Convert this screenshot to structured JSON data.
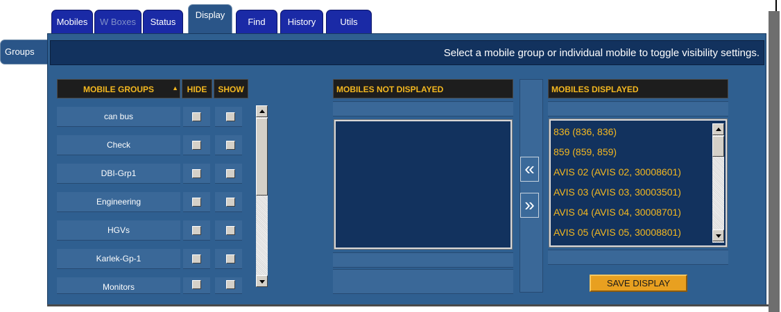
{
  "tabs": [
    {
      "label": "Mobiles",
      "active": false,
      "disabled": false
    },
    {
      "label": "W Boxes",
      "active": false,
      "disabled": true
    },
    {
      "label": "Status",
      "active": false,
      "disabled": false
    },
    {
      "label": "Display",
      "active": true,
      "disabled": false
    },
    {
      "label": "Find",
      "active": false,
      "disabled": false
    },
    {
      "label": "History",
      "active": false,
      "disabled": false
    },
    {
      "label": "Utils",
      "active": false,
      "disabled": false
    }
  ],
  "side_tab": {
    "label": "Groups"
  },
  "info_message": "Select a mobile group or individual mobile to toggle visibility settings.",
  "groups_table": {
    "headers": {
      "groups": "MOBILE GROUPS",
      "hide": "HIDE",
      "show": "SHOW"
    },
    "rows": [
      "can bus",
      "Check",
      "DBI-Grp1",
      "Engineering",
      "HGVs",
      "Karlek-Gp-1",
      "Monitors"
    ]
  },
  "not_displayed": {
    "header": "MOBILES NOT DISPLAYED",
    "items": []
  },
  "displayed": {
    "header": "MOBILES DISPLAYED",
    "items": [
      "836 (836, 836)",
      "859 (859, 859)",
      "AVIS 02 (AVIS  02, 30008601)",
      "AVIS 03 (AVIS 03, 30003501)",
      "AVIS 04 (AVIS 04, 30008701)",
      "AVIS 05 (AVIS 05, 30008801)"
    ]
  },
  "move_buttons": {
    "left": "«",
    "right": "»"
  },
  "save_button": {
    "label": "SAVE DISPLAY"
  },
  "colors": {
    "tab_blue": "#1a2aa6",
    "panel_blue": "#2f5f90",
    "dark_navy": "#12325e",
    "header_gold": "#f4b820",
    "save_orange": "#e8a020"
  }
}
